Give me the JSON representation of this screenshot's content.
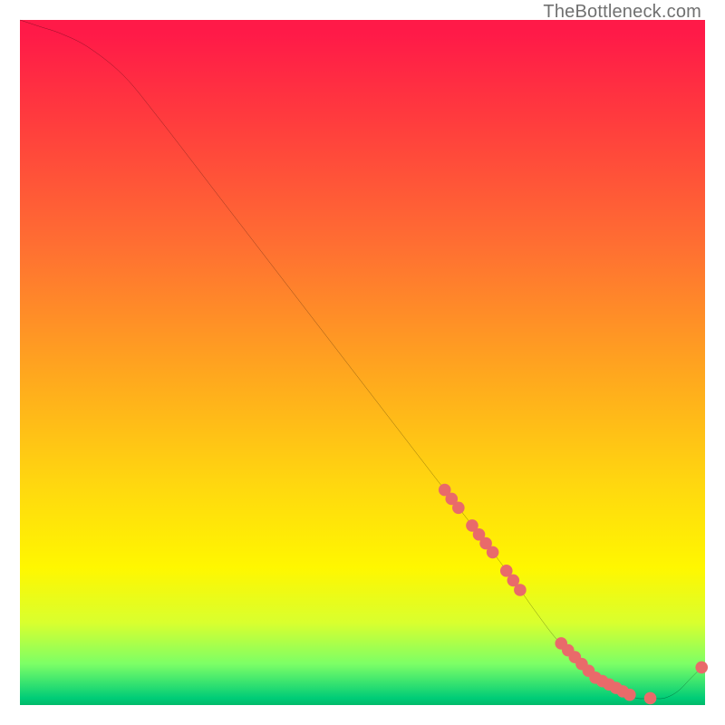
{
  "watermark": "TheBottleneck.com",
  "chart_data": {
    "type": "line",
    "title": "",
    "xlabel": "",
    "ylabel": "",
    "xlim": [
      0,
      100
    ],
    "ylim": [
      0,
      100
    ],
    "grid": false,
    "series": [
      {
        "name": "bottleneck-curve",
        "x": [
          0,
          3,
          6,
          10,
          15,
          20,
          30,
          40,
          50,
          60,
          70,
          75,
          78,
          80,
          82,
          84,
          86,
          88,
          90,
          92,
          94,
          96,
          98,
          100
        ],
        "values": [
          100,
          99,
          98,
          96,
          92,
          86,
          73,
          60,
          47,
          34,
          21,
          14,
          10,
          8,
          6,
          4,
          3,
          2,
          1,
          1,
          1,
          2,
          4,
          6
        ]
      }
    ],
    "marker_band": {
      "name": "highlighted-segment",
      "color": "#e96a6a",
      "points_x": [
        62,
        63,
        64,
        66,
        67,
        68,
        69,
        71,
        72,
        73,
        79,
        80,
        81,
        82,
        83,
        84,
        85,
        86,
        87,
        88,
        89,
        92,
        99.5
      ],
      "comment": "Markers lie on the curve; y taken from curve at each x."
    },
    "background_gradient_stops": [
      {
        "pos": 0.0,
        "color": "#ff1a48"
      },
      {
        "pos": 0.14,
        "color": "#ff3a3e"
      },
      {
        "pos": 0.33,
        "color": "#ff6f32"
      },
      {
        "pos": 0.52,
        "color": "#ffa81e"
      },
      {
        "pos": 0.68,
        "color": "#ffd80f"
      },
      {
        "pos": 0.8,
        "color": "#fff700"
      },
      {
        "pos": 0.88,
        "color": "#d9ff2e"
      },
      {
        "pos": 0.94,
        "color": "#7cff66"
      },
      {
        "pos": 0.99,
        "color": "#00cc77"
      },
      {
        "pos": 1.0,
        "color": "#00b96a"
      }
    ]
  }
}
